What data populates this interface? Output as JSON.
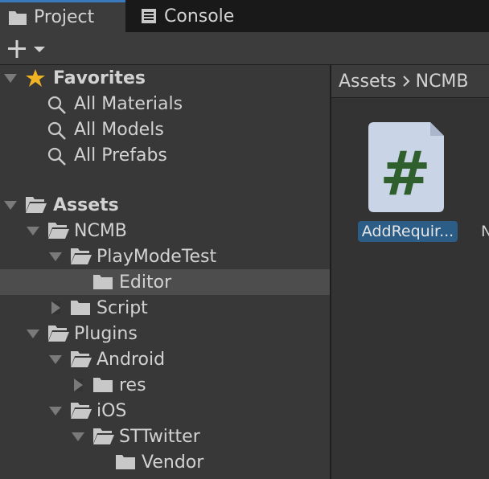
{
  "tabs": [
    {
      "label": "Project",
      "icon": "folder-icon",
      "active": true
    },
    {
      "label": "Console",
      "icon": "console-icon",
      "active": false
    }
  ],
  "toolbar": {
    "create_icon": "plus-icon",
    "dropdown_icon": "chevron-down-icon"
  },
  "favorites": {
    "title": "Favorites",
    "items": [
      "All Materials",
      "All Models",
      "All Prefabs"
    ]
  },
  "assets": {
    "title": "Assets",
    "ncmb": "NCMB",
    "play_mode_test": "PlayModeTest",
    "editor": "Editor",
    "script": "Script",
    "plugins": "Plugins",
    "android": "Android",
    "res": "res",
    "ios": "iOS",
    "sttwitter": "STTwitter",
    "vendor": "Vendor"
  },
  "breadcrumb": {
    "root": "Assets",
    "separator": ">",
    "current": "NCMB"
  },
  "grid": {
    "items": [
      {
        "label": "AddRequir...",
        "icon": "csharp-script-icon",
        "glyph": "#"
      },
      {
        "label": "N",
        "icon": "",
        "glyph": ""
      }
    ]
  },
  "colors": {
    "selection": "#2c5d87",
    "tab_accent": "#3a79bb",
    "script_glyph": "#2f5f2c",
    "star": "#f0b323"
  }
}
